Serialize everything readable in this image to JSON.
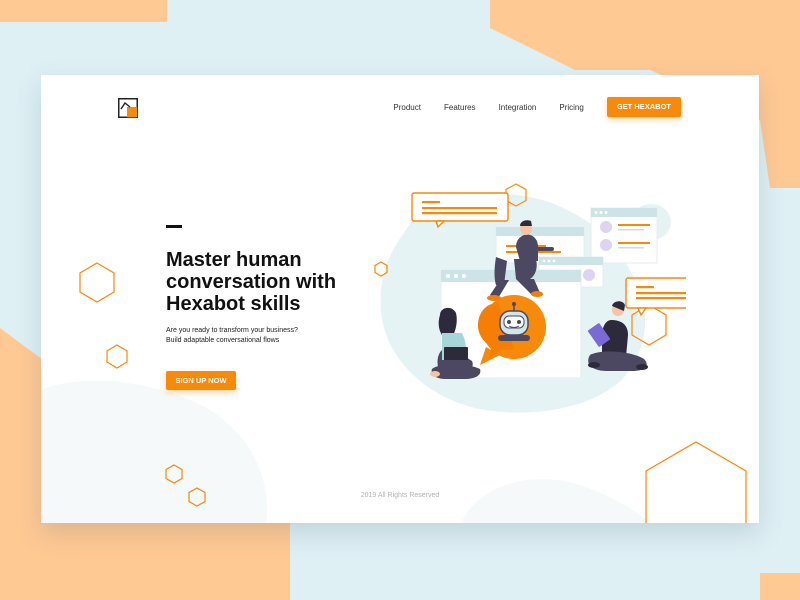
{
  "nav": {
    "items": [
      "Product",
      "Features",
      "Integration",
      "Pricing"
    ],
    "cta_label": "GET HEXABOT"
  },
  "hero": {
    "title": "Master human conversation with Hexabot skills",
    "subtitle_line1": "Are you ready to transform your business?",
    "subtitle_line2": "Build adaptable conversational flows",
    "cta_label": "SIGN UP NOW"
  },
  "footer": {
    "copyright": "2019 All Rights Reserved"
  },
  "colors": {
    "accent": "#f7890b",
    "peach": "#ffc994",
    "sky": "#def0f4",
    "blob": "#e6f3f5",
    "card": "#ffffff",
    "text": "#111111",
    "purple": "#4c4862"
  },
  "icons": [
    "logo-icon",
    "robot-icon",
    "chat-bubble-icon",
    "hexagon-icon",
    "laptop-icon",
    "tablet-icon"
  ]
}
